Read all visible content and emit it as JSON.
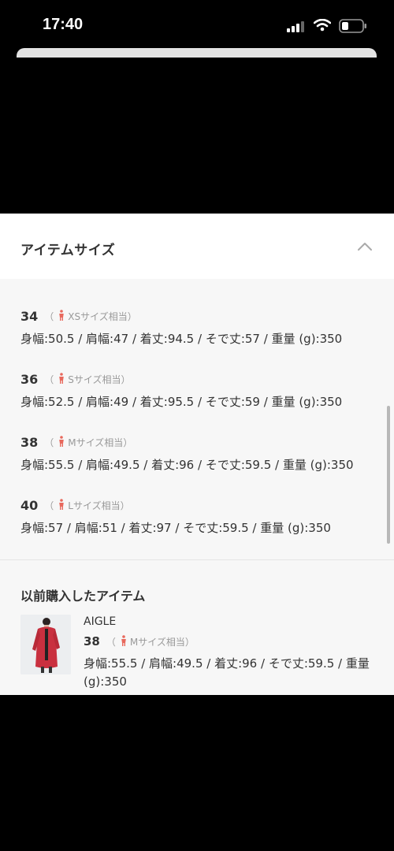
{
  "status_bar": {
    "time": "17:40",
    "icons": [
      "cellular-signal-icon",
      "wifi-icon",
      "battery-icon"
    ]
  },
  "panel": {
    "title": "アイテムサイズ",
    "collapse_icon": "chevron-up-icon",
    "sizes": [
      {
        "size": "34",
        "paren_open": "（",
        "note": "XSサイズ相当）",
        "dims": "身幅:50.5 / 肩幅:47 / 着丈:94.5 / そで丈:57 / 重量 (g):350"
      },
      {
        "size": "36",
        "paren_open": "（",
        "note": "Sサイズ相当）",
        "dims": "身幅:52.5 / 肩幅:49 / 着丈:95.5 / そで丈:59 / 重量 (g):350"
      },
      {
        "size": "38",
        "paren_open": "（",
        "note": "Mサイズ相当）",
        "dims": "身幅:55.5 / 肩幅:49.5 / 着丈:96 / そで丈:59.5 / 重量 (g):350"
      },
      {
        "size": "40",
        "paren_open": "（",
        "note": "Lサイズ相当）",
        "dims": "身幅:57 / 肩幅:51 / 着丈:97 / そで丈:59.5 / 重量 (g):350"
      }
    ],
    "previous_purchase": {
      "title": "以前購入したアイテム",
      "brand": "AIGLE",
      "size": "38",
      "paren_open": "（",
      "note": "Mサイズ相当）",
      "dims": "身幅:55.5 / 肩幅:49.5 / 着丈:96 / そで丈:59.5 / 重量 (g):350"
    }
  },
  "colors": {
    "person_icon": "#e8685c",
    "panel_bg": "#f7f7f7",
    "overlay": "#000000"
  }
}
